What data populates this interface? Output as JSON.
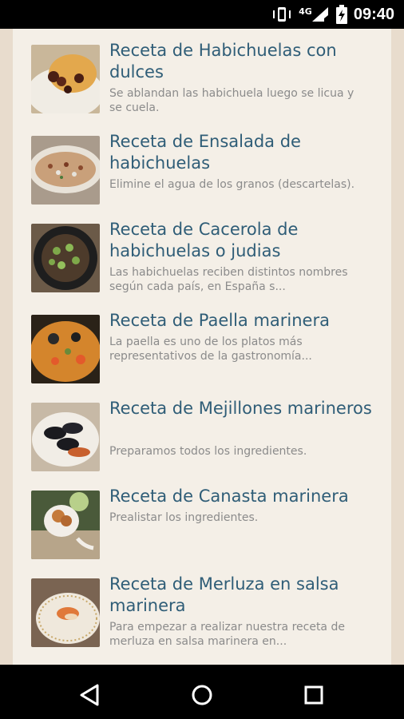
{
  "status": {
    "time": "09:40",
    "network": "4G"
  },
  "recipes": [
    {
      "title": "Receta de Habichuelas con dulces",
      "description": "Se ablandan las habichuela luego se licua y se cuela."
    },
    {
      "title": "Receta de Ensalada de habichuelas",
      "description": "Elimine el agua de los granos (descartelas)."
    },
    {
      "title": "Receta de Cacerola de habichuelas o judias",
      "description": "Las habichuelas reciben distintos nombres según cada país, en España s..."
    },
    {
      "title": "Receta de Paella marinera",
      "description": "La paella es uno de los platos más representativos de la gastronomía..."
    },
    {
      "title": "Receta de Mejillones marineros",
      "description": "Preparamos todos los ingredientes."
    },
    {
      "title": "Receta de Canasta marinera",
      "description": "Prealistar los ingredientes."
    },
    {
      "title": "Receta de Merluza en salsa marinera",
      "description": "Para empezar a realizar nuestra receta de merluza en salsa marinera en..."
    }
  ]
}
